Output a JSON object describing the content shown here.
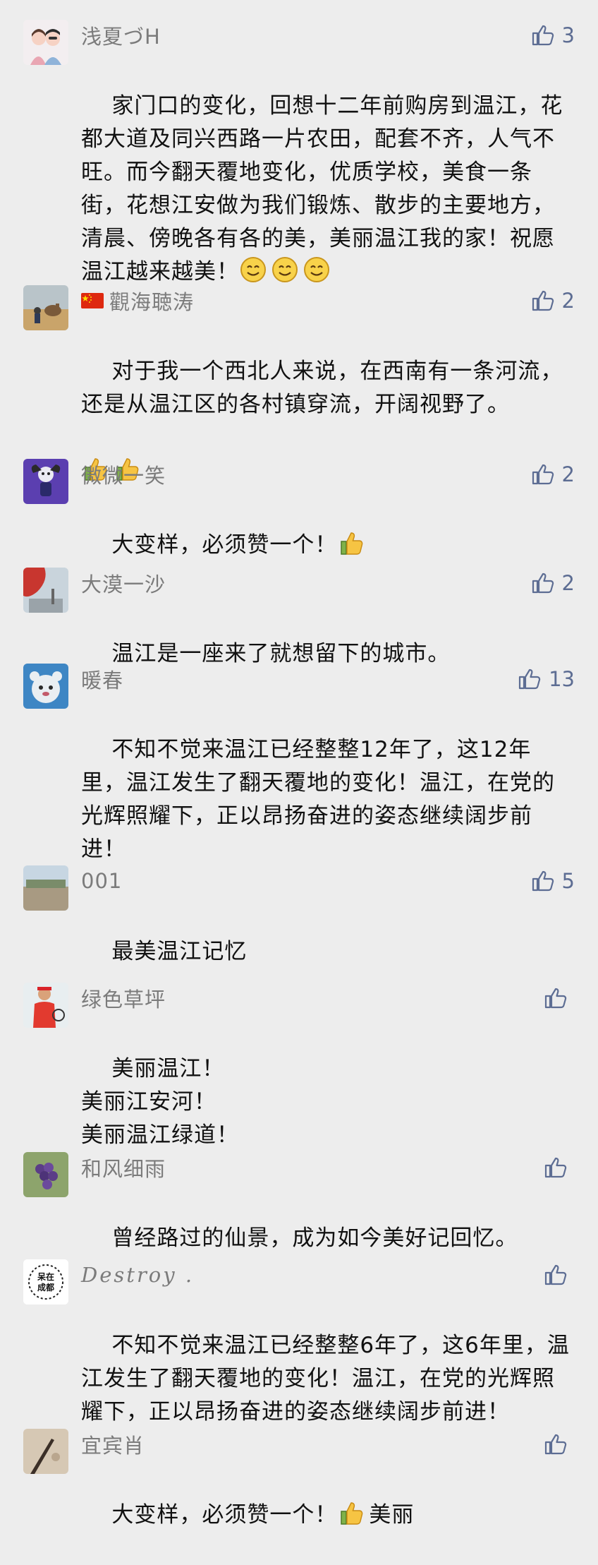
{
  "comments": [
    {
      "name": "浅夏づH",
      "likes": "3",
      "text": "家门口的变化，回想十二年前购房到温江，花都大道及同兴西路一片农田，配套不齐，人气不旺。而今翻天覆地变化，优质学校，美食一条街，花想江安做为我们锻炼、散步的主要地方，清晨、傍晚各有各的美，美丽温江我的家！祝愿温江越来越美！",
      "emojis": [
        "smile-emoji",
        "smile-emoji",
        "smile-emoji"
      ]
    },
    {
      "name": "觀海聴涛",
      "likes": "2",
      "text": "对于我一个西北人来说，在西南有一条河流，还是从温江区的各村镇穿流，开阔视野了。",
      "emojis": [
        "thumbs-up-emoji",
        "thumbs-up-emoji"
      ]
    },
    {
      "name": "微微一笑",
      "likes": "2",
      "text": "大变样，必须赞一个！",
      "emojis": [
        "thumbs-up-emoji"
      ]
    },
    {
      "name": "大漠一沙",
      "likes": "2",
      "text": "温江是一座来了就想留下的城市。"
    },
    {
      "name": "暖春",
      "likes": "13",
      "text": "不知不觉来温江已经整整12年了，这12年里，温江发生了翻天覆地的变化！温江，在党的光辉照耀下，正以昂扬奋进的姿态继续阔步前进！"
    },
    {
      "name": "001",
      "likes": "5",
      "text": "最美温江记忆"
    },
    {
      "name": "绿色草坪",
      "likes": "",
      "text": "美丽温江！\n美丽江安河！\n美丽温江绿道！"
    },
    {
      "name": "和风细雨",
      "likes": "",
      "text": "曾经路过的仙景，成为如今美好记回忆。"
    },
    {
      "name": "Destroy .",
      "likes": "",
      "text": "不知不觉来温江已经整整6年了，这6年里，温江发生了翻天覆地的变化！温江，在党的光辉照耀下，正以昂扬奋进的姿态继续阔步前进！",
      "avatar_text": [
        "呆在",
        "成都"
      ]
    },
    {
      "name": "宜宾肖",
      "likes": "",
      "text_before": "大变样，必须赞一个！",
      "emojis": [
        "thumbs-up-emoji"
      ],
      "text_after": "美丽"
    }
  ],
  "colors": {
    "background": "#ededed",
    "name": "#7b7b7b",
    "like_accent": "#5d6d93",
    "text": "#111111"
  }
}
